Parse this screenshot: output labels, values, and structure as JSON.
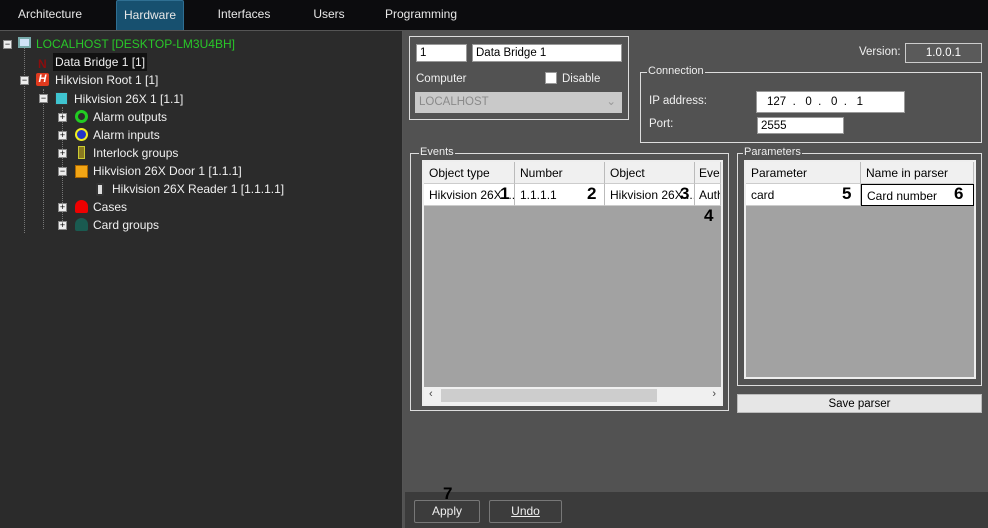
{
  "tabs": [
    {
      "label": "Architecture"
    },
    {
      "label": "Hardware",
      "active": true
    },
    {
      "label": "Interfaces"
    },
    {
      "label": "Users"
    },
    {
      "label": "Programming"
    }
  ],
  "tree": {
    "root": "LOCALHOST [DESKTOP-LM3U4BH]",
    "data_bridge": "Data Bridge 1 [1]",
    "hik_root": "Hikvision Root 1 [1]",
    "hik_device": "Hikvision 26X 1 [1.1]",
    "alarm_outputs": "Alarm outputs",
    "alarm_inputs": "Alarm inputs",
    "interlock": "Interlock groups",
    "door": "Hikvision 26X Door 1 [1.1.1]",
    "reader": "Hikvision 26X Reader 1 [1.1.1.1]",
    "cases": "Cases",
    "card_groups": "Card groups"
  },
  "object": {
    "id": "1",
    "name": "Data Bridge 1",
    "computer_label": "Computer",
    "disable_label": "Disable",
    "computer_value": "LOCALHOST",
    "version_label": "Version:",
    "version": "1.0.0.1"
  },
  "connection": {
    "title": "Connection",
    "ip_label": "IP address:",
    "ip": [
      "127",
      ".",
      "0",
      ".",
      "0",
      ".",
      "1"
    ],
    "port_label": "Port:",
    "port": "2555"
  },
  "events": {
    "title": "Events",
    "columns": [
      "Object type",
      "Number",
      "Object",
      "Ever"
    ],
    "rows": [
      [
        "Hikvision 26X ...",
        "1.1.1.1",
        "Hikvision 26X ...",
        "Auth"
      ]
    ]
  },
  "parameters": {
    "title": "Parameters",
    "columns": [
      "Parameter",
      "Name in parser"
    ],
    "rows": [
      [
        "card",
        "Card number"
      ]
    ],
    "save_label": "Save parser"
  },
  "markers": [
    "1",
    "2",
    "3",
    "4",
    "5",
    "6",
    "7"
  ],
  "footer": {
    "apply": "Apply",
    "undo": "Undo"
  },
  "colors": {
    "accent_tab": "#17506f",
    "root_text": "#29c729"
  }
}
